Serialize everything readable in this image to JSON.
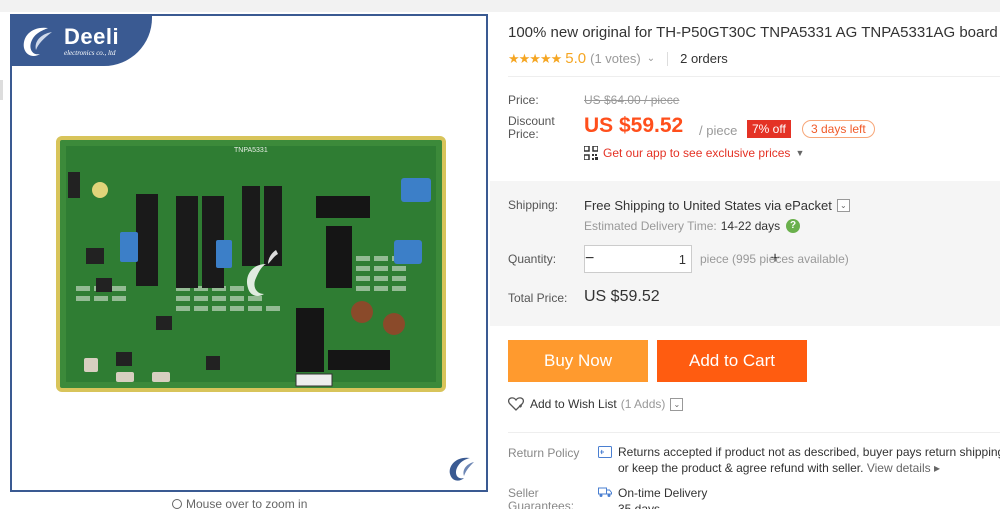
{
  "brand": {
    "name": "Deeli",
    "tagline": "electronics co., ltd"
  },
  "board_label": "TNPA5331",
  "zoom_hint": "Mouse over to zoom in",
  "product": {
    "title": "100% new original for TH-P50GT30C TNPA5331 AG TNPA5331AG board",
    "stars": "★★★★★",
    "rating": "5.0",
    "votes": "(1 votes)",
    "orders": "2 orders"
  },
  "price": {
    "price_label": "Price:",
    "original": "US $64.00 / piece",
    "discount_label_1": "Discount",
    "discount_label_2": "Price:",
    "discount": "US $59.52",
    "per": "/ piece",
    "off_badge": "7% off",
    "days_left": "3 days left",
    "app_promo": "Get our app to see exclusive prices"
  },
  "shipping": {
    "label": "Shipping:",
    "text": "Free Shipping to United States via ePacket",
    "estimate_label": "Estimated Delivery Time:",
    "estimate_value": "14-22 days"
  },
  "quantity": {
    "label": "Quantity:",
    "value": "1",
    "minus": "−",
    "plus": "+",
    "available": "piece (995 pieces available)"
  },
  "total": {
    "label": "Total Price:",
    "value": "US $59.52"
  },
  "actions": {
    "buy_now": "Buy Now",
    "add_to_cart": "Add to Cart"
  },
  "wishlist": {
    "label": "Add to Wish List",
    "adds": "(1 Adds)"
  },
  "return_policy": {
    "label": "Return Policy",
    "line1": "Returns accepted if product not as described, buyer pays return shipping fee;",
    "line2": "or keep the product & agree refund with seller.",
    "view_details": "View details ▸"
  },
  "guarantee": {
    "label_1": "Seller",
    "label_2": "Guarantees:",
    "delivery": "On-time Delivery",
    "days": "35 days"
  },
  "colors": {
    "accent_orange": "#ff5c10",
    "buy_orange": "#ff9a2e",
    "price_red": "#ff4f1c",
    "frame_blue": "#3a5a92",
    "star": "#f5a623"
  }
}
